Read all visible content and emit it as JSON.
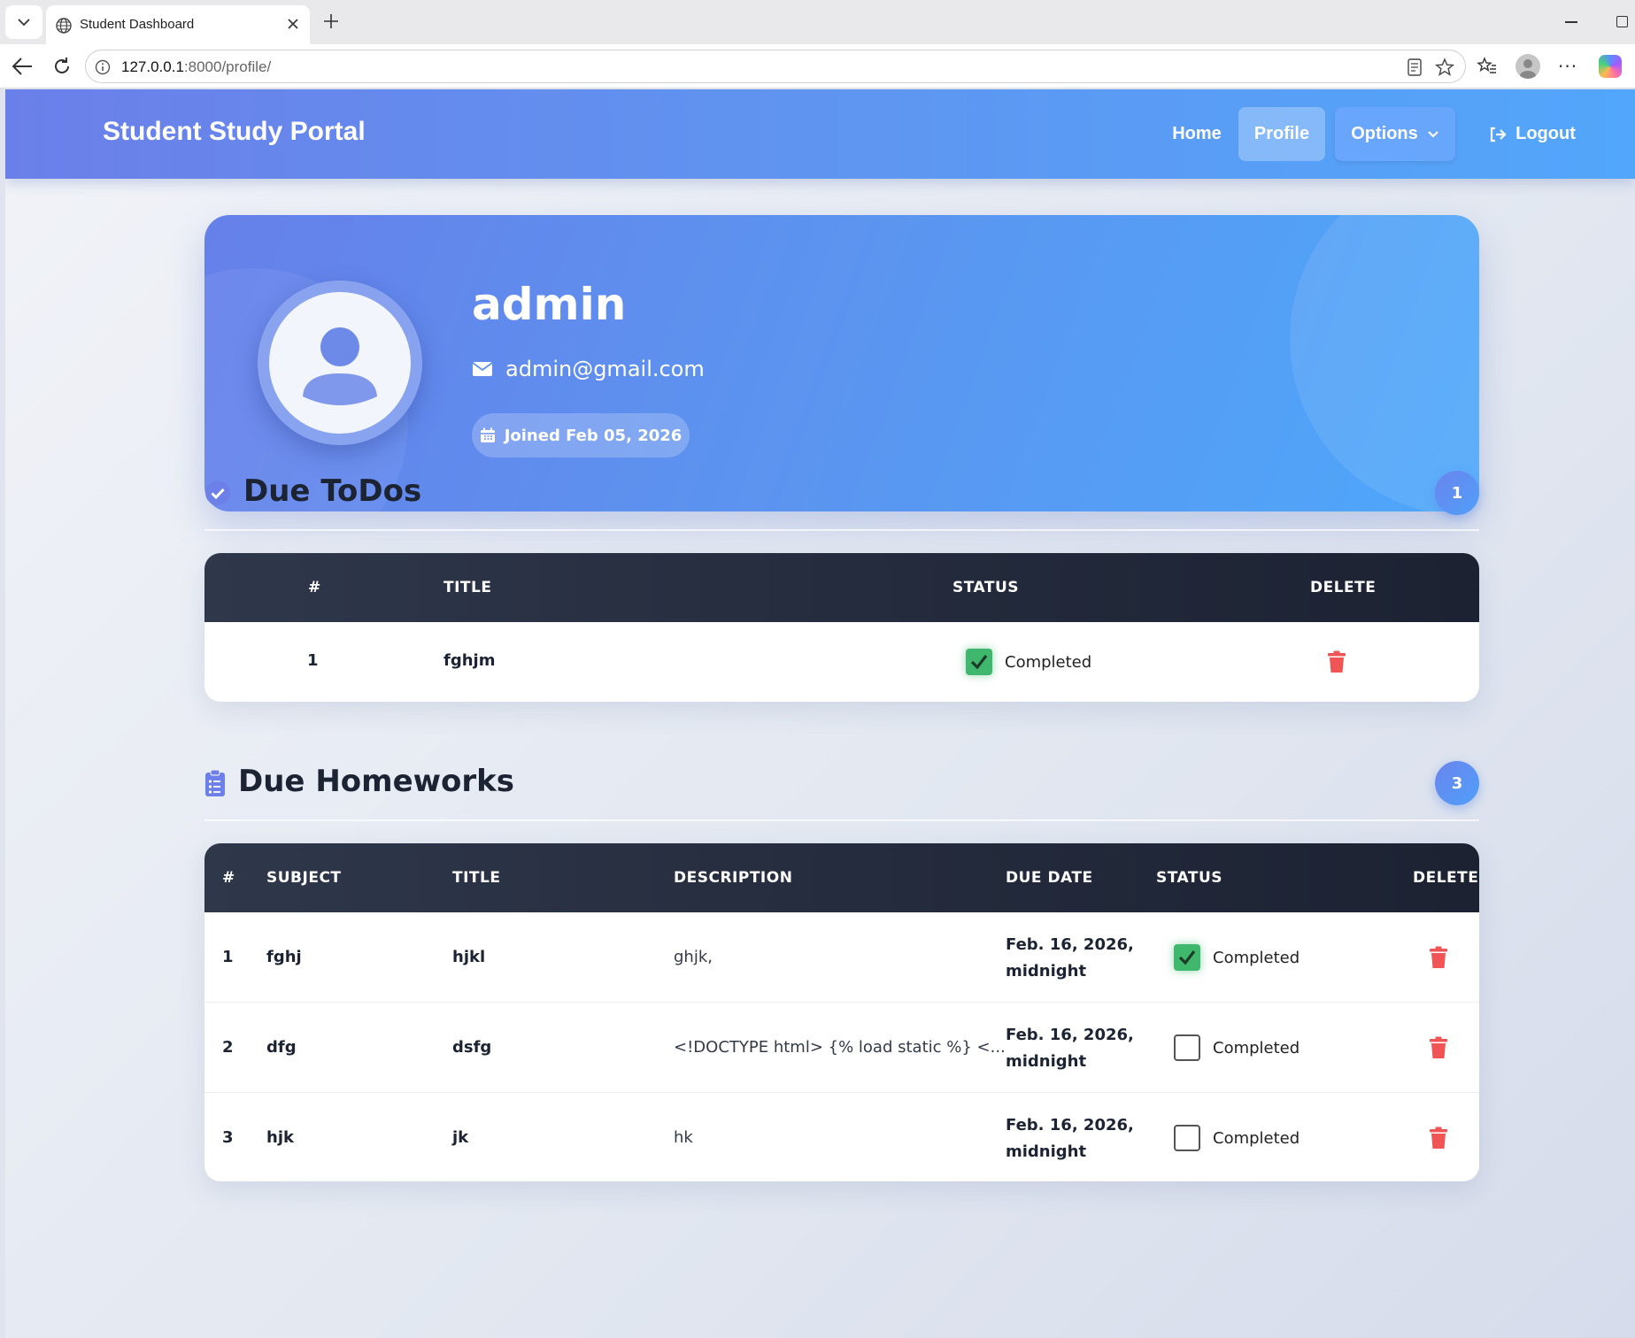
{
  "browser": {
    "tab_title": "Student Dashboard",
    "url_host": "127.0.0.1",
    "url_path": ":8000/profile/"
  },
  "navbar": {
    "brand": "Student Study Portal",
    "home": "Home",
    "profile": "Profile",
    "options": "Options",
    "logout": "Logout"
  },
  "profile": {
    "username": "admin",
    "email": "admin@gmail.com",
    "joined": "Joined Feb 05, 2026"
  },
  "todos": {
    "title": "Due ToDos",
    "count": "1",
    "headers": {
      "num": "#",
      "title": "TITLE",
      "status": "STATUS",
      "delete": "DELETE"
    },
    "rows": [
      {
        "num": "1",
        "title": "fghjm",
        "status": "Completed",
        "checked": true
      }
    ]
  },
  "homeworks": {
    "title": "Due Homeworks",
    "count": "3",
    "headers": {
      "num": "#",
      "subject": "SUBJECT",
      "title": "TITLE",
      "description": "DESCRIPTION",
      "due": "DUE DATE",
      "status": "STATUS",
      "delete": "DELETE"
    },
    "rows": [
      {
        "num": "1",
        "subject": "fghj",
        "title": "hjkl",
        "description": "ghjk,",
        "due_line1": "Feb. 16, 2026,",
        "due_line2": "midnight",
        "status": "Completed",
        "checked": true
      },
      {
        "num": "2",
        "subject": "dfg",
        "title": "dsfg",
        "description": "<!DOCTYPE html> {% load static %} <...",
        "due_line1": "Feb. 16, 2026,",
        "due_line2": "midnight",
        "status": "Completed",
        "checked": false
      },
      {
        "num": "3",
        "subject": "hjk",
        "title": "jk",
        "description": "hk",
        "due_line1": "Feb. 16, 2026,",
        "due_line2": "midnight",
        "status": "Completed",
        "checked": false
      }
    ]
  },
  "colors": {
    "accent": "#5b95f0",
    "check_green": "#3fb86d",
    "delete_red": "#f05454",
    "table_header": "#232a3b"
  }
}
